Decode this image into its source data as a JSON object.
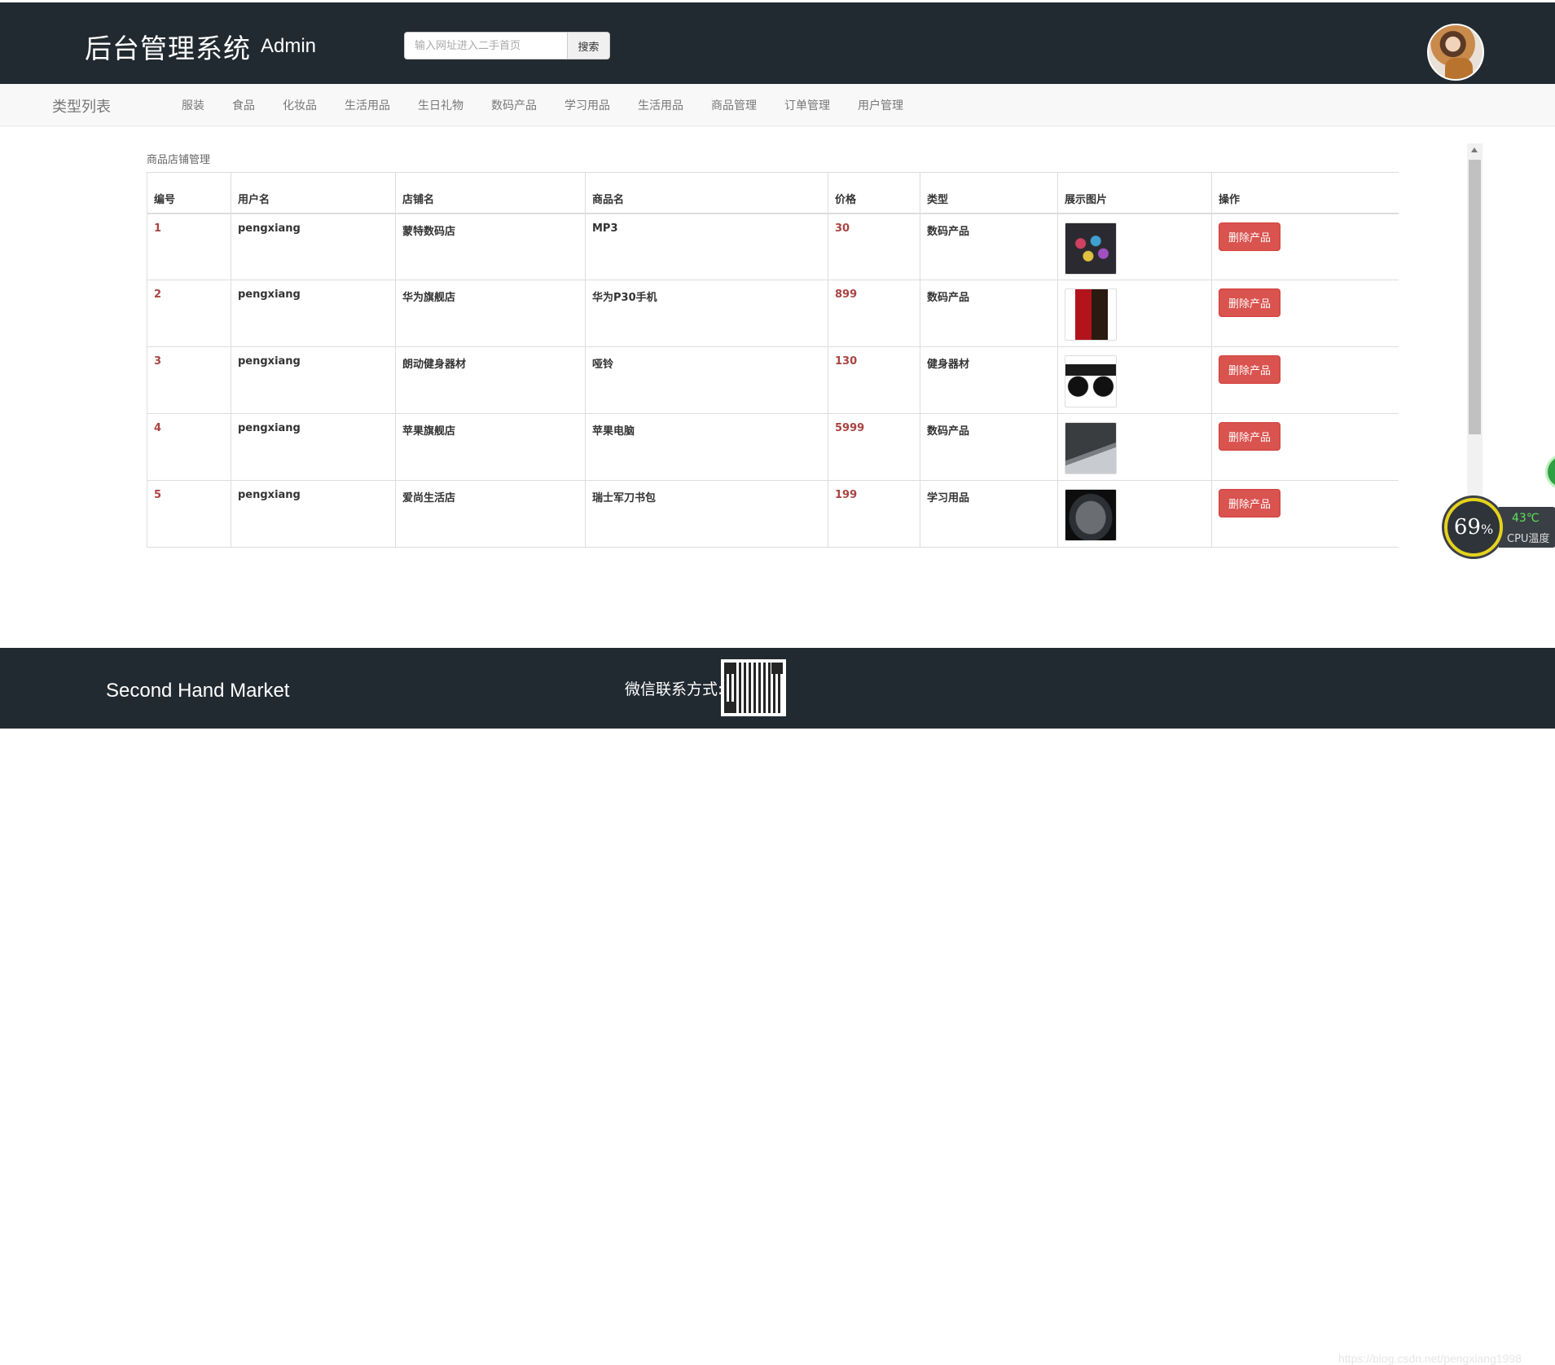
{
  "header": {
    "title": "后台管理系统",
    "subtitle": "Admin",
    "search_placeholder": "输入网址进入二手首页",
    "search_button": "搜索"
  },
  "nav": {
    "title": "类型列表",
    "items": [
      "服装",
      "食品",
      "化妆品",
      "生活用品",
      "生日礼物",
      "数码产品",
      "学习用品",
      "生活用品",
      "商品管理",
      "订单管理",
      "用户管理"
    ]
  },
  "main": {
    "section_label": "商品店铺管理",
    "table": {
      "headers": [
        "编号",
        "用户名",
        "店铺名",
        "商品名",
        "价格",
        "类型",
        "展示图片",
        "操作"
      ],
      "rows": [
        {
          "id": "1",
          "user": "pengxiang",
          "shop": "蒙特数码店",
          "product": "MP3",
          "price": "30",
          "type": "数码产品",
          "action": "删除产品"
        },
        {
          "id": "2",
          "user": "pengxiang",
          "shop": "华为旗舰店",
          "product": "华为P30手机",
          "price": "899",
          "type": "数码产品",
          "action": "删除产品"
        },
        {
          "id": "3",
          "user": "pengxiang",
          "shop": "朗动健身器材",
          "product": "哑铃",
          "price": "130",
          "type": "健身器材",
          "action": "删除产品"
        },
        {
          "id": "4",
          "user": "pengxiang",
          "shop": "苹果旗舰店",
          "product": "苹果电脑",
          "price": "5999",
          "type": "数码产品",
          "action": "删除产品"
        },
        {
          "id": "5",
          "user": "pengxiang",
          "shop": "爱尚生活店",
          "product": "瑞士军刀书包",
          "price": "199",
          "type": "学习用品",
          "action": "删除产品"
        }
      ]
    }
  },
  "cpu_widget": {
    "percent": "69",
    "percent_unit": "%",
    "temperature": "43℃",
    "label": "CPU温度"
  },
  "footer": {
    "brand": "Second Hand Market",
    "wechat_label": "微信联系方式:",
    "watermark": "https://blog.csdn.net/pengxiang1998"
  },
  "colors": {
    "header_bg": "#222a31",
    "danger": "#d9534f",
    "price_red": "#a94442"
  }
}
